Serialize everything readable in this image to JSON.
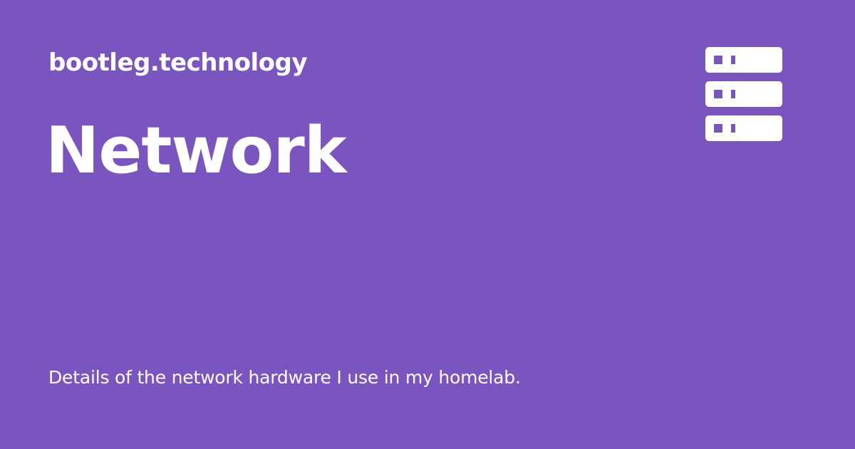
{
  "site": {
    "name": "bootleg.technology"
  },
  "page": {
    "title": "Network",
    "description": "Details of the network hardware I use in my homelab."
  },
  "icon": {
    "name": "server-icon"
  },
  "colors": {
    "background": "#7b55bf",
    "foreground": "#ffffff"
  }
}
